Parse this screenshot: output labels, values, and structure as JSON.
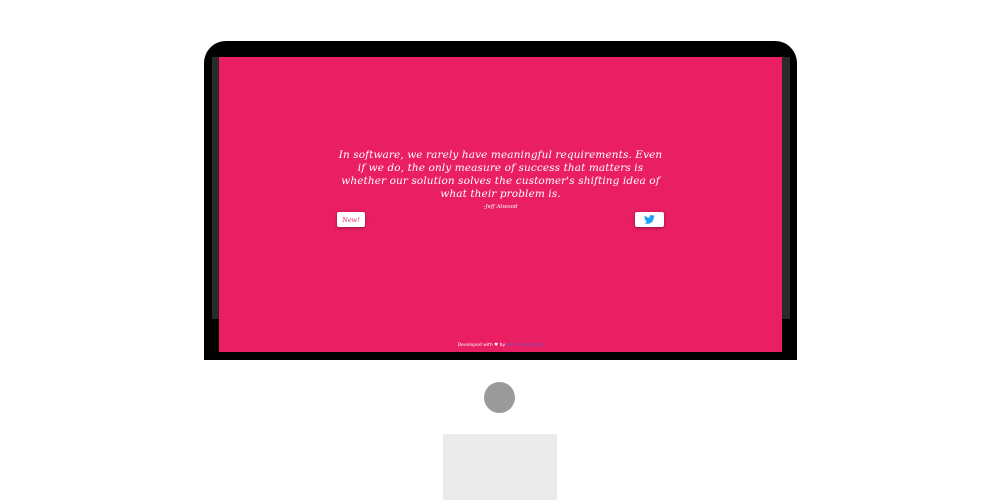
{
  "quote": {
    "text": "In software, we rarely have meaningful requirements. Even if we do, the only measure of success that matters is whether our solution solves the customer's shifting idea of what their problem is.",
    "author": "-Jeff Atwood"
  },
  "buttons": {
    "new_label": "New!",
    "tweet_icon": "twitter-bird-icon"
  },
  "footer": {
    "prefix": "Developed with ",
    "heart": "♥",
    "by": " by ",
    "author": "Aarti Kanchanlal"
  },
  "colors": {
    "background": "#e91e63",
    "twitter": "#1da1f2"
  }
}
